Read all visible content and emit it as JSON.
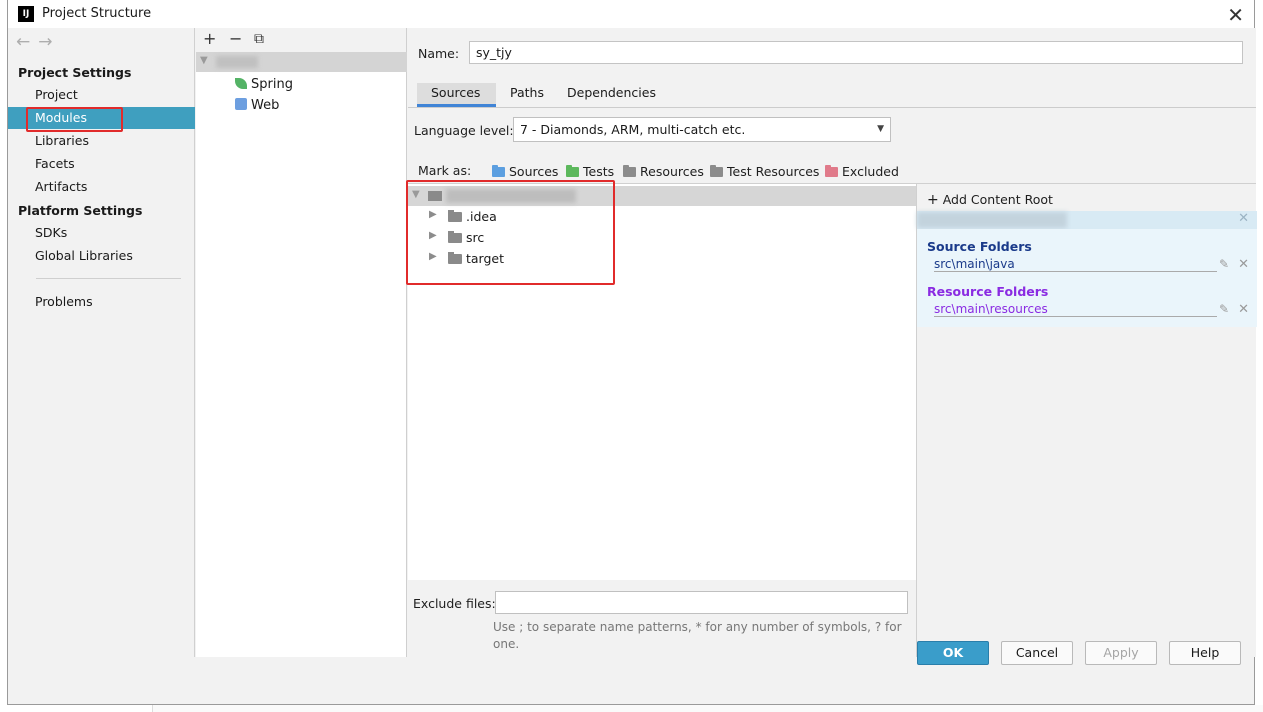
{
  "window": {
    "title": "Project Structure",
    "logo_text": "IJ"
  },
  "left_panel": {
    "back_arrow": "←",
    "forward_arrow": "→",
    "project_settings_heading": "Project Settings",
    "project_settings_items": [
      "Project",
      "Modules",
      "Libraries",
      "Facets",
      "Artifacts"
    ],
    "platform_settings_heading": "Platform Settings",
    "platform_settings_items": [
      "SDKs",
      "Global Libraries"
    ],
    "problems_label": "Problems",
    "selected_item": "Modules"
  },
  "module_tree": {
    "toolbar_add": "+",
    "toolbar_remove": "−",
    "toolbar_copy": "⧉",
    "facets": [
      "Spring",
      "Web"
    ]
  },
  "main": {
    "name_label": "Name:",
    "name_value": "sy_tjy",
    "tabs": [
      "Sources",
      "Paths",
      "Dependencies"
    ],
    "active_tab": "Sources",
    "language_level_label": "Language level:",
    "language_level_value": "7 - Diamonds, ARM, multi-catch etc.",
    "mark_as_label": "Mark as:",
    "mark_as_options": [
      {
        "label": "Sources",
        "color": "#5c9fe0"
      },
      {
        "label": "Tests",
        "color": "#5cb85c"
      },
      {
        "label": "Resources",
        "color": "#8c8c8c"
      },
      {
        "label": "Test Resources",
        "color": "#8c8c8c"
      },
      {
        "label": "Excluded",
        "color": "#e07a8a"
      }
    ],
    "tree_children": [
      ".idea",
      "src",
      "target"
    ],
    "exclude_files_label": "Exclude files:",
    "exclude_files_value": "",
    "exclude_hint": "Use ; to separate name patterns, * for any number of symbols, ? for one."
  },
  "content_roots": {
    "add_content_root_label": "Add Content Root",
    "source_folders_heading": "Source Folders",
    "source_folders_color": "#1a3a8a",
    "source_folder_path": "src\\main\\java",
    "resource_folders_heading": "Resource Folders",
    "resource_folders_color": "#8a2be2",
    "resource_folder_path": "src\\main\\resources"
  },
  "buttons": {
    "ok": "OK",
    "cancel": "Cancel",
    "apply": "Apply",
    "help": "Help"
  }
}
